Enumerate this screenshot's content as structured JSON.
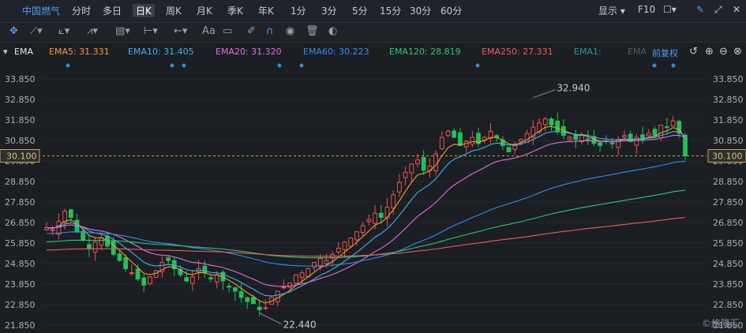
{
  "toolbar": {
    "stock_name": "中国燃气",
    "periods": [
      "分时",
      "多日",
      "日K",
      "周K",
      "月K",
      "季K",
      "年K",
      "1分",
      "3分",
      "5分",
      "15分",
      "30分",
      "60分"
    ],
    "active_period": "日K",
    "display_label": "显示",
    "f10_label": "F10"
  },
  "indicator": {
    "name": "EMA",
    "fuquan_label": "前复权",
    "lines": [
      {
        "label": "EMA5: 31.331",
        "color": "#f0a030"
      },
      {
        "label": "EMA10: 31.405",
        "color": "#3cb4f0"
      },
      {
        "label": "EMA20: 31.320",
        "color": "#e070e0"
      },
      {
        "label": "EMA60: 30.223",
        "color": "#2f8ff0"
      },
      {
        "label": "EMA120: 28.819",
        "color": "#28c878"
      },
      {
        "label": "EMA250: 27.331",
        "color": "#f05a5a"
      },
      {
        "label": "EMA1:",
        "color": "#2a9a8a"
      },
      {
        "label": "EMA",
        "color": "#5a5f66"
      }
    ]
  },
  "watermark": "©格隆汇",
  "chart_data": {
    "type": "candlestick",
    "price_ticks": [
      "33.850",
      "32.850",
      "31.850",
      "30.850",
      "29.850",
      "28.850",
      "27.850",
      "26.850",
      "25.850",
      "24.850",
      "23.850",
      "22.850",
      "21.850"
    ],
    "ylim": [
      21.85,
      33.85
    ],
    "last_price": "30.100",
    "high_annotation": "32.940",
    "low_annotation": "22.440",
    "bottom_right_label": "21.850",
    "up_color": "#f05050",
    "down_color": "#22c05a",
    "closes": [
      26.6,
      26.5,
      26.9,
      27.4,
      27.1,
      26.4,
      26.0,
      25.6,
      25.9,
      26.1,
      25.7,
      25.3,
      25.0,
      24.6,
      24.4,
      24.1,
      23.8,
      24.2,
      24.5,
      24.9,
      25.0,
      24.6,
      24.3,
      24.0,
      24.2,
      24.6,
      24.4,
      24.1,
      24.3,
      24.0,
      23.7,
      23.5,
      23.2,
      23.0,
      22.9,
      22.6,
      22.7,
      23.2,
      23.5,
      23.7,
      23.9,
      24.3,
      24.4,
      24.6,
      24.9,
      25.1,
      25.0,
      25.3,
      25.6,
      25.9,
      26.1,
      26.4,
      26.7,
      27.0,
      27.3,
      27.1,
      27.6,
      28.2,
      28.8,
      29.3,
      29.7,
      29.9,
      29.4,
      29.6,
      30.2,
      31.0,
      31.3,
      31.0,
      30.6,
      30.8,
      31.0,
      30.7,
      31.0,
      31.3,
      31.0,
      30.6,
      30.3,
      30.6,
      30.9,
      31.2,
      31.5,
      31.7,
      31.9,
      31.6,
      31.3,
      31.1,
      31.0,
      30.9,
      31.1,
      30.9,
      30.7,
      30.6,
      30.8,
      30.7,
      30.9,
      31.1,
      30.8,
      31.0,
      30.9,
      31.2,
      31.1,
      31.6,
      31.5,
      31.8,
      31.2,
      30.1
    ],
    "ema5_last": 31.331,
    "ema10_last": 31.405,
    "ema20_last": 31.32,
    "ema60_last": 30.223,
    "ema120_last": 28.819,
    "ema250_last": 27.331
  }
}
